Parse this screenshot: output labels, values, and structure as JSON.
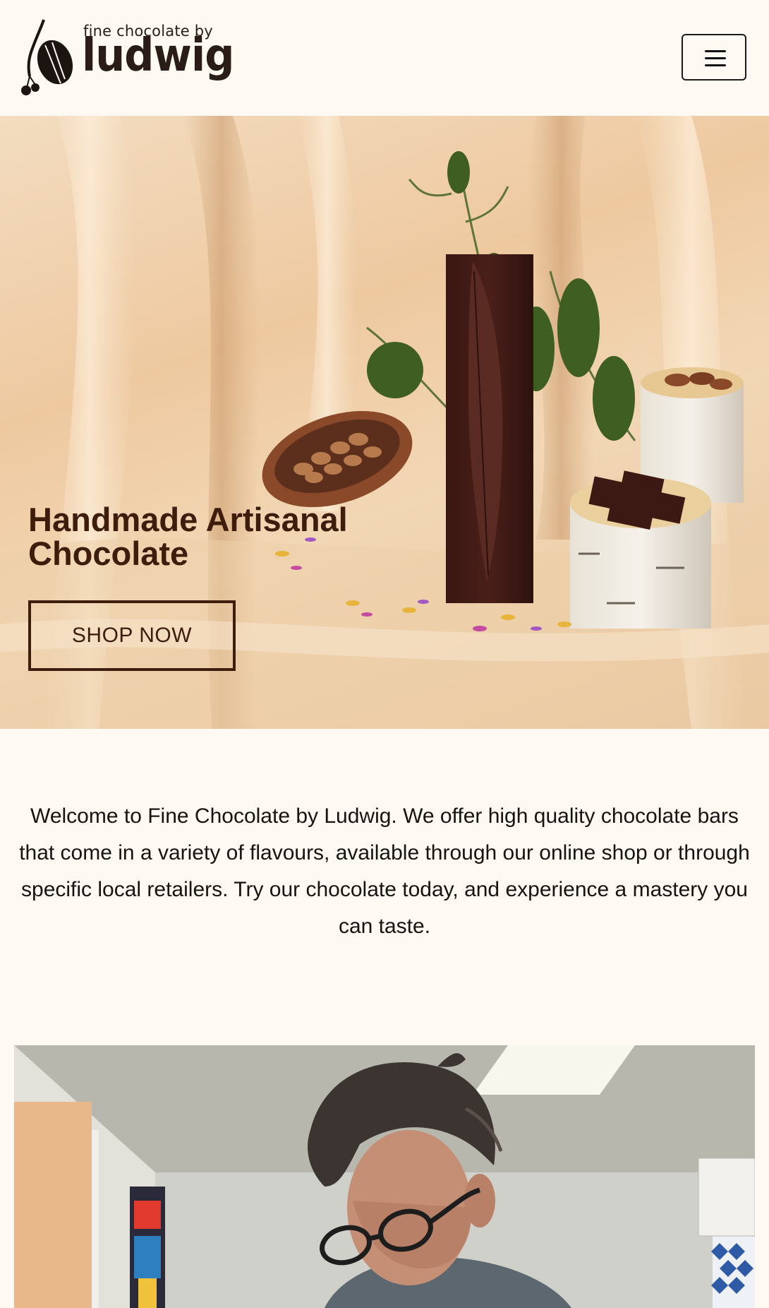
{
  "header": {
    "logo_small": "fine chocolate by",
    "logo_big": "ludwig",
    "menu_icon": "hamburger-menu-icon"
  },
  "hero": {
    "title": "Handmade Artisanal Chocolate",
    "cta_label": "SHOP NOW"
  },
  "intro": {
    "text": "Welcome to Fine Chocolate by Ludwig. We offer high quality chocolate bars that come in a variety of flavours, available through our online shop or through specific local retailers. Try our chocolate today, and experience a mastery you can taste."
  },
  "colors": {
    "page_background": "#fefaf3",
    "hero_text": "#3e1d0d",
    "body_text": "#171310"
  }
}
